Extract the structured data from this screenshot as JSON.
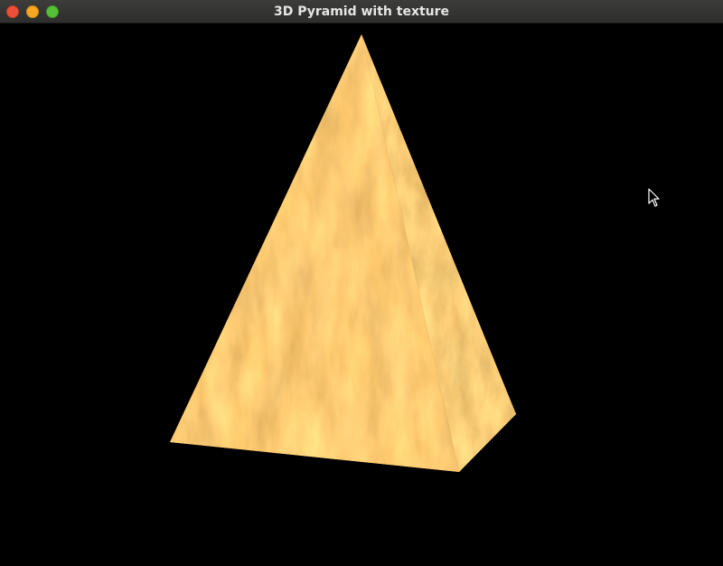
{
  "window": {
    "title": "3D Pyramid with texture",
    "background_color": "#000000"
  },
  "titlebar": {
    "close_button": "close",
    "minimize_button": "minimize",
    "maximize_button": "maximize"
  },
  "scene": {
    "object": "pyramid",
    "texture": "marble-orange-texture",
    "texture_colors": [
      "#e0a050",
      "#c57a30",
      "#f2d49a",
      "#8a5a28"
    ]
  },
  "cursor": {
    "icon": "arrow-pointer-icon"
  }
}
